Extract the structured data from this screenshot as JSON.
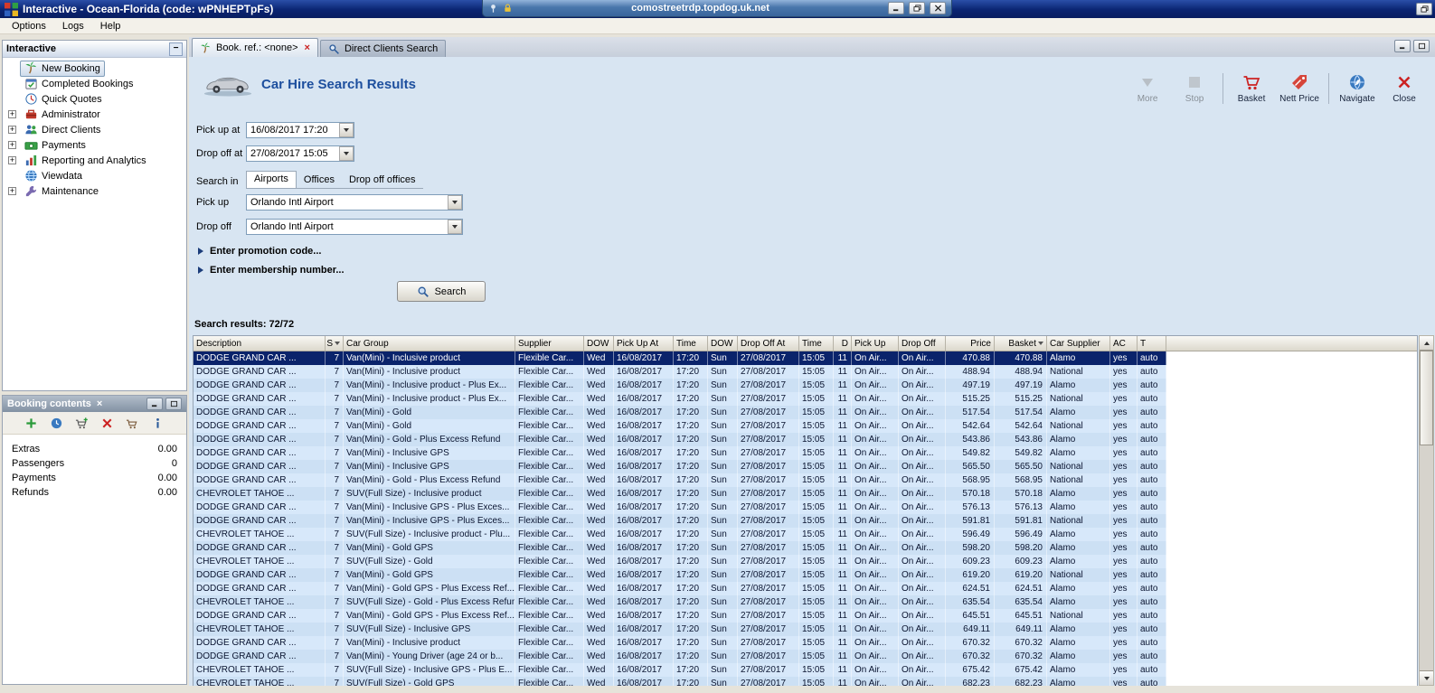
{
  "window": {
    "title": "Interactive - Ocean-Florida (code: wPNHEPTpFs)"
  },
  "rdp": {
    "title": "comostreetrdp.topdog.uk.net"
  },
  "menu": {
    "items": [
      "Options",
      "Logs",
      "Help"
    ]
  },
  "sidebar": {
    "title": "Interactive",
    "items": [
      {
        "label": "New Booking",
        "icon": "palm-icon",
        "selected": true,
        "expandable": false
      },
      {
        "label": "Completed Bookings",
        "icon": "completed-bookings-icon",
        "expandable": false
      },
      {
        "label": "Quick Quotes",
        "icon": "quick-quotes-icon",
        "expandable": false
      },
      {
        "label": "Administrator",
        "icon": "administrator-icon",
        "expandable": true
      },
      {
        "label": "Direct Clients",
        "icon": "direct-clients-icon",
        "expandable": true
      },
      {
        "label": "Payments",
        "icon": "payments-icon",
        "expandable": true
      },
      {
        "label": "Reporting and Analytics",
        "icon": "reporting-icon",
        "expandable": true
      },
      {
        "label": "Viewdata",
        "icon": "viewdata-icon",
        "expandable": false
      },
      {
        "label": "Maintenance",
        "icon": "maintenance-icon",
        "expandable": true
      }
    ]
  },
  "booking_panel": {
    "title": "Booking contents",
    "toolbar": [
      {
        "icon": "add-icon"
      },
      {
        "icon": "view-icon"
      },
      {
        "icon": "add-to-basket-icon"
      },
      {
        "icon": "delete-icon"
      },
      {
        "icon": "basket-icon"
      },
      {
        "icon": "info-icon"
      }
    ],
    "rows": [
      {
        "label": "Extras",
        "value": "0.00"
      },
      {
        "label": "Passengers",
        "value": "0"
      },
      {
        "label": "Payments",
        "value": "0.00"
      },
      {
        "label": "Refunds",
        "value": "0.00"
      }
    ]
  },
  "tabs": [
    {
      "label": "Book. ref.: <none>",
      "icon": "palm-icon",
      "active": true,
      "closable": true
    },
    {
      "label": "Direct Clients Search",
      "icon": "client-search-icon",
      "active": false,
      "closable": false
    }
  ],
  "page": {
    "title": "Car Hire Search Results",
    "toolbar": [
      {
        "label": "More",
        "icon": "more-icon",
        "disabled": true
      },
      {
        "label": "Stop",
        "icon": "stop-icon",
        "disabled": true,
        "sep_after": true
      },
      {
        "label": "Basket",
        "icon": "basket-red-icon"
      },
      {
        "label": "Nett Price",
        "icon": "nett-price-icon",
        "sep_after": true
      },
      {
        "label": "Navigate",
        "icon": "navigate-icon"
      },
      {
        "label": "Close",
        "icon": "close-red-icon"
      }
    ]
  },
  "form": {
    "pick_up_at": {
      "label": "Pick up at",
      "value": "16/08/2017 17:20"
    },
    "drop_off_at": {
      "label": "Drop off at",
      "value": "27/08/2017 15:05"
    },
    "search_in": {
      "label": "Search in",
      "options": [
        "Airports",
        "Offices",
        "Drop off offices"
      ],
      "selected": "Airports"
    },
    "pick_up": {
      "label": "Pick up",
      "value": "Orlando Intl Airport"
    },
    "drop_off": {
      "label": "Drop off",
      "value": "Orlando Intl Airport"
    },
    "promotion": "Enter promotion code...",
    "membership": "Enter membership number...",
    "search_button": "Search"
  },
  "results": {
    "summary": "Search results: 72/72",
    "selected_row": 0,
    "colors": {
      "selected_row": "#0a236b",
      "row_blue": "#cce0f4",
      "title_blue": "#1d4f9e"
    },
    "columns": [
      {
        "label": "Description"
      },
      {
        "label": "S",
        "sort": true
      },
      {
        "label": "Car Group"
      },
      {
        "label": "Supplier"
      },
      {
        "label": "DOW"
      },
      {
        "label": "Pick Up At"
      },
      {
        "label": "Time"
      },
      {
        "label": "DOW"
      },
      {
        "label": "Drop Off At"
      },
      {
        "label": "Time"
      },
      {
        "label": "D"
      },
      {
        "label": "Pick Up"
      },
      {
        "label": "Drop Off"
      },
      {
        "label": "Price"
      },
      {
        "label": "Basket",
        "sort": true
      },
      {
        "label": "Car Supplier"
      },
      {
        "label": "AC"
      },
      {
        "label": "T"
      }
    ],
    "rows": [
      [
        "DODGE GRAND CAR ...",
        "7",
        "Van(Mini) - Inclusive product",
        "Flexible Car...",
        "Wed",
        "16/08/2017",
        "17:20",
        "Sun",
        "27/08/2017",
        "15:05",
        "11",
        "On Air...",
        "On Air...",
        "470.88",
        "470.88",
        "Alamo",
        "yes",
        "auto"
      ],
      [
        "DODGE GRAND CAR ...",
        "7",
        "Van(Mini) - Inclusive product",
        "Flexible Car...",
        "Wed",
        "16/08/2017",
        "17:20",
        "Sun",
        "27/08/2017",
        "15:05",
        "11",
        "On Air...",
        "On Air...",
        "488.94",
        "488.94",
        "National",
        "yes",
        "auto"
      ],
      [
        "DODGE GRAND CAR ...",
        "7",
        "Van(Mini) - Inclusive product - Plus Ex...",
        "Flexible Car...",
        "Wed",
        "16/08/2017",
        "17:20",
        "Sun",
        "27/08/2017",
        "15:05",
        "11",
        "On Air...",
        "On Air...",
        "497.19",
        "497.19",
        "Alamo",
        "yes",
        "auto"
      ],
      [
        "DODGE GRAND CAR ...",
        "7",
        "Van(Mini) - Inclusive product - Plus Ex...",
        "Flexible Car...",
        "Wed",
        "16/08/2017",
        "17:20",
        "Sun",
        "27/08/2017",
        "15:05",
        "11",
        "On Air...",
        "On Air...",
        "515.25",
        "515.25",
        "National",
        "yes",
        "auto"
      ],
      [
        "DODGE GRAND CAR ...",
        "7",
        "Van(Mini) - Gold",
        "Flexible Car...",
        "Wed",
        "16/08/2017",
        "17:20",
        "Sun",
        "27/08/2017",
        "15:05",
        "11",
        "On Air...",
        "On Air...",
        "517.54",
        "517.54",
        "Alamo",
        "yes",
        "auto"
      ],
      [
        "DODGE GRAND CAR ...",
        "7",
        "Van(Mini) - Gold",
        "Flexible Car...",
        "Wed",
        "16/08/2017",
        "17:20",
        "Sun",
        "27/08/2017",
        "15:05",
        "11",
        "On Air...",
        "On Air...",
        "542.64",
        "542.64",
        "National",
        "yes",
        "auto"
      ],
      [
        "DODGE GRAND CAR ...",
        "7",
        "Van(Mini) - Gold - Plus Excess Refund",
        "Flexible Car...",
        "Wed",
        "16/08/2017",
        "17:20",
        "Sun",
        "27/08/2017",
        "15:05",
        "11",
        "On Air...",
        "On Air...",
        "543.86",
        "543.86",
        "Alamo",
        "yes",
        "auto"
      ],
      [
        "DODGE GRAND CAR ...",
        "7",
        "Van(Mini) - Inclusive GPS",
        "Flexible Car...",
        "Wed",
        "16/08/2017",
        "17:20",
        "Sun",
        "27/08/2017",
        "15:05",
        "11",
        "On Air...",
        "On Air...",
        "549.82",
        "549.82",
        "Alamo",
        "yes",
        "auto"
      ],
      [
        "DODGE GRAND CAR ...",
        "7",
        "Van(Mini) - Inclusive GPS",
        "Flexible Car...",
        "Wed",
        "16/08/2017",
        "17:20",
        "Sun",
        "27/08/2017",
        "15:05",
        "11",
        "On Air...",
        "On Air...",
        "565.50",
        "565.50",
        "National",
        "yes",
        "auto"
      ],
      [
        "DODGE GRAND CAR ...",
        "7",
        "Van(Mini) - Gold - Plus Excess Refund",
        "Flexible Car...",
        "Wed",
        "16/08/2017",
        "17:20",
        "Sun",
        "27/08/2017",
        "15:05",
        "11",
        "On Air...",
        "On Air...",
        "568.95",
        "568.95",
        "National",
        "yes",
        "auto"
      ],
      [
        "CHEVROLET TAHOE ...",
        "7",
        "SUV(Full Size) - Inclusive product",
        "Flexible Car...",
        "Wed",
        "16/08/2017",
        "17:20",
        "Sun",
        "27/08/2017",
        "15:05",
        "11",
        "On Air...",
        "On Air...",
        "570.18",
        "570.18",
        "Alamo",
        "yes",
        "auto"
      ],
      [
        "DODGE GRAND CAR ...",
        "7",
        "Van(Mini) - Inclusive GPS - Plus Exces...",
        "Flexible Car...",
        "Wed",
        "16/08/2017",
        "17:20",
        "Sun",
        "27/08/2017",
        "15:05",
        "11",
        "On Air...",
        "On Air...",
        "576.13",
        "576.13",
        "Alamo",
        "yes",
        "auto"
      ],
      [
        "DODGE GRAND CAR ...",
        "7",
        "Van(Mini) - Inclusive GPS - Plus Exces...",
        "Flexible Car...",
        "Wed",
        "16/08/2017",
        "17:20",
        "Sun",
        "27/08/2017",
        "15:05",
        "11",
        "On Air...",
        "On Air...",
        "591.81",
        "591.81",
        "National",
        "yes",
        "auto"
      ],
      [
        "CHEVROLET TAHOE ...",
        "7",
        "SUV(Full Size) - Inclusive product - Plu...",
        "Flexible Car...",
        "Wed",
        "16/08/2017",
        "17:20",
        "Sun",
        "27/08/2017",
        "15:05",
        "11",
        "On Air...",
        "On Air...",
        "596.49",
        "596.49",
        "Alamo",
        "yes",
        "auto"
      ],
      [
        "DODGE GRAND CAR ...",
        "7",
        "Van(Mini) - Gold GPS",
        "Flexible Car...",
        "Wed",
        "16/08/2017",
        "17:20",
        "Sun",
        "27/08/2017",
        "15:05",
        "11",
        "On Air...",
        "On Air...",
        "598.20",
        "598.20",
        "Alamo",
        "yes",
        "auto"
      ],
      [
        "CHEVROLET TAHOE ...",
        "7",
        "SUV(Full Size) - Gold",
        "Flexible Car...",
        "Wed",
        "16/08/2017",
        "17:20",
        "Sun",
        "27/08/2017",
        "15:05",
        "11",
        "On Air...",
        "On Air...",
        "609.23",
        "609.23",
        "Alamo",
        "yes",
        "auto"
      ],
      [
        "DODGE GRAND CAR ...",
        "7",
        "Van(Mini) - Gold GPS",
        "Flexible Car...",
        "Wed",
        "16/08/2017",
        "17:20",
        "Sun",
        "27/08/2017",
        "15:05",
        "11",
        "On Air...",
        "On Air...",
        "619.20",
        "619.20",
        "National",
        "yes",
        "auto"
      ],
      [
        "DODGE GRAND CAR ...",
        "7",
        "Van(Mini) - Gold GPS - Plus Excess Ref...",
        "Flexible Car...",
        "Wed",
        "16/08/2017",
        "17:20",
        "Sun",
        "27/08/2017",
        "15:05",
        "11",
        "On Air...",
        "On Air...",
        "624.51",
        "624.51",
        "Alamo",
        "yes",
        "auto"
      ],
      [
        "CHEVROLET TAHOE ...",
        "7",
        "SUV(Full Size) - Gold - Plus Excess Refund",
        "Flexible Car...",
        "Wed",
        "16/08/2017",
        "17:20",
        "Sun",
        "27/08/2017",
        "15:05",
        "11",
        "On Air...",
        "On Air...",
        "635.54",
        "635.54",
        "Alamo",
        "yes",
        "auto"
      ],
      [
        "DODGE GRAND CAR ...",
        "7",
        "Van(Mini) - Gold GPS - Plus Excess Ref...",
        "Flexible Car...",
        "Wed",
        "16/08/2017",
        "17:20",
        "Sun",
        "27/08/2017",
        "15:05",
        "11",
        "On Air...",
        "On Air...",
        "645.51",
        "645.51",
        "National",
        "yes",
        "auto"
      ],
      [
        "CHEVROLET TAHOE ...",
        "7",
        "SUV(Full Size) - Inclusive GPS",
        "Flexible Car...",
        "Wed",
        "16/08/2017",
        "17:20",
        "Sun",
        "27/08/2017",
        "15:05",
        "11",
        "On Air...",
        "On Air...",
        "649.11",
        "649.11",
        "Alamo",
        "yes",
        "auto"
      ],
      [
        "DODGE GRAND CAR ...",
        "7",
        "Van(Mini) - Inclusive product",
        "Flexible Car...",
        "Wed",
        "16/08/2017",
        "17:20",
        "Sun",
        "27/08/2017",
        "15:05",
        "11",
        "On Air...",
        "On Air...",
        "670.32",
        "670.32",
        "Alamo",
        "yes",
        "auto"
      ],
      [
        "DODGE GRAND CAR ...",
        "7",
        "Van(Mini) - Young Driver (age 24 or b...",
        "Flexible Car...",
        "Wed",
        "16/08/2017",
        "17:20",
        "Sun",
        "27/08/2017",
        "15:05",
        "11",
        "On Air...",
        "On Air...",
        "670.32",
        "670.32",
        "Alamo",
        "yes",
        "auto"
      ],
      [
        "CHEVROLET TAHOE ...",
        "7",
        "SUV(Full Size) - Inclusive GPS - Plus E...",
        "Flexible Car...",
        "Wed",
        "16/08/2017",
        "17:20",
        "Sun",
        "27/08/2017",
        "15:05",
        "11",
        "On Air...",
        "On Air...",
        "675.42",
        "675.42",
        "Alamo",
        "yes",
        "auto"
      ],
      [
        "CHEVROLET TAHOE ...",
        "7",
        "SUV(Full Size) - Gold GPS",
        "Flexible Car...",
        "Wed",
        "16/08/2017",
        "17:20",
        "Sun",
        "27/08/2017",
        "15:05",
        "11",
        "On Air...",
        "On Air...",
        "682.23",
        "682.23",
        "Alamo",
        "yes",
        "auto"
      ]
    ]
  }
}
